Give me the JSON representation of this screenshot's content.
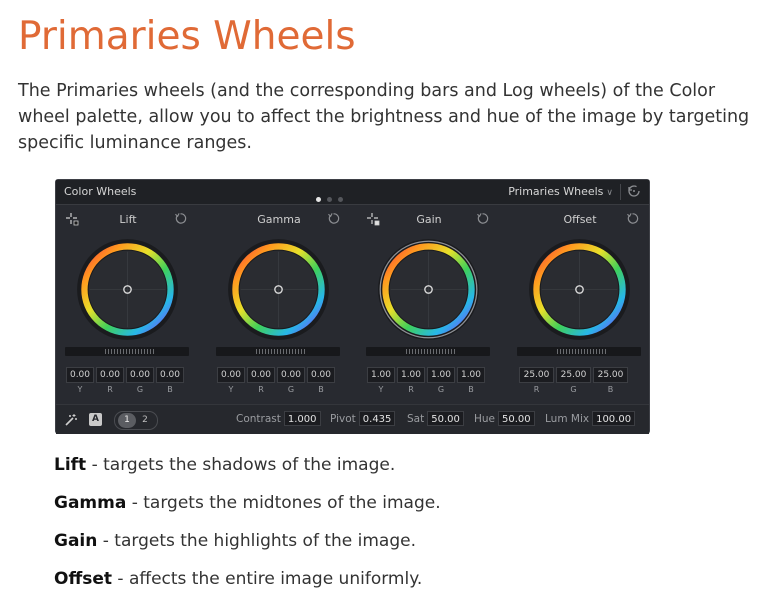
{
  "page": {
    "title": "Primaries Wheels",
    "intro": "The Primaries wheels (and the corresponding bars and Log wheels) of the Color wheel palette, allow you to affect the brightness and hue of the image by targeting specific luminance ranges."
  },
  "panel": {
    "title": "Color Wheels",
    "mode_label": "Primaries Wheels",
    "page_dots": 3,
    "active_dot": 1
  },
  "wheels": [
    {
      "name": "Lift",
      "values": [
        "0.00",
        "0.00",
        "0.00",
        "0.00"
      ],
      "channels": [
        "Y",
        "R",
        "G",
        "B"
      ]
    },
    {
      "name": "Gamma",
      "values": [
        "0.00",
        "0.00",
        "0.00",
        "0.00"
      ],
      "channels": [
        "Y",
        "R",
        "G",
        "B"
      ]
    },
    {
      "name": "Gain",
      "values": [
        "1.00",
        "1.00",
        "1.00",
        "1.00"
      ],
      "channels": [
        "Y",
        "R",
        "G",
        "B"
      ]
    },
    {
      "name": "Offset",
      "values": [
        "25.00",
        "25.00",
        "25.00"
      ],
      "channels": [
        "R",
        "G",
        "B"
      ]
    }
  ],
  "footer": {
    "auto_badge": "A",
    "pages": [
      "1",
      "2"
    ],
    "active_page": "1",
    "contrast": {
      "label": "Contrast",
      "value": "1.000"
    },
    "pivot": {
      "label": "Pivot",
      "value": "0.435"
    },
    "sat": {
      "label": "Sat",
      "value": "50.00"
    },
    "hue": {
      "label": "Hue",
      "value": "50.00"
    },
    "lum_mix": {
      "label": "Lum Mix",
      "value": "100.00"
    }
  },
  "definitions": [
    {
      "term": "Lift",
      "desc": " - targets the shadows of the image."
    },
    {
      "term": "Gamma",
      "desc": " - targets the midtones of the image."
    },
    {
      "term": "Gain",
      "desc": " - targets the highlights of the image."
    },
    {
      "term": "Offset",
      "desc": " - affects the entire image uniformly."
    }
  ],
  "colors": {
    "title": "#e06a36",
    "panel_bg": "#282a30"
  },
  "icons": {
    "picker": "color-picker-icon",
    "reset": "reset-icon",
    "auto_balance": "auto-balance-wand-icon",
    "mode_chevron": "chevron-down-icon"
  }
}
